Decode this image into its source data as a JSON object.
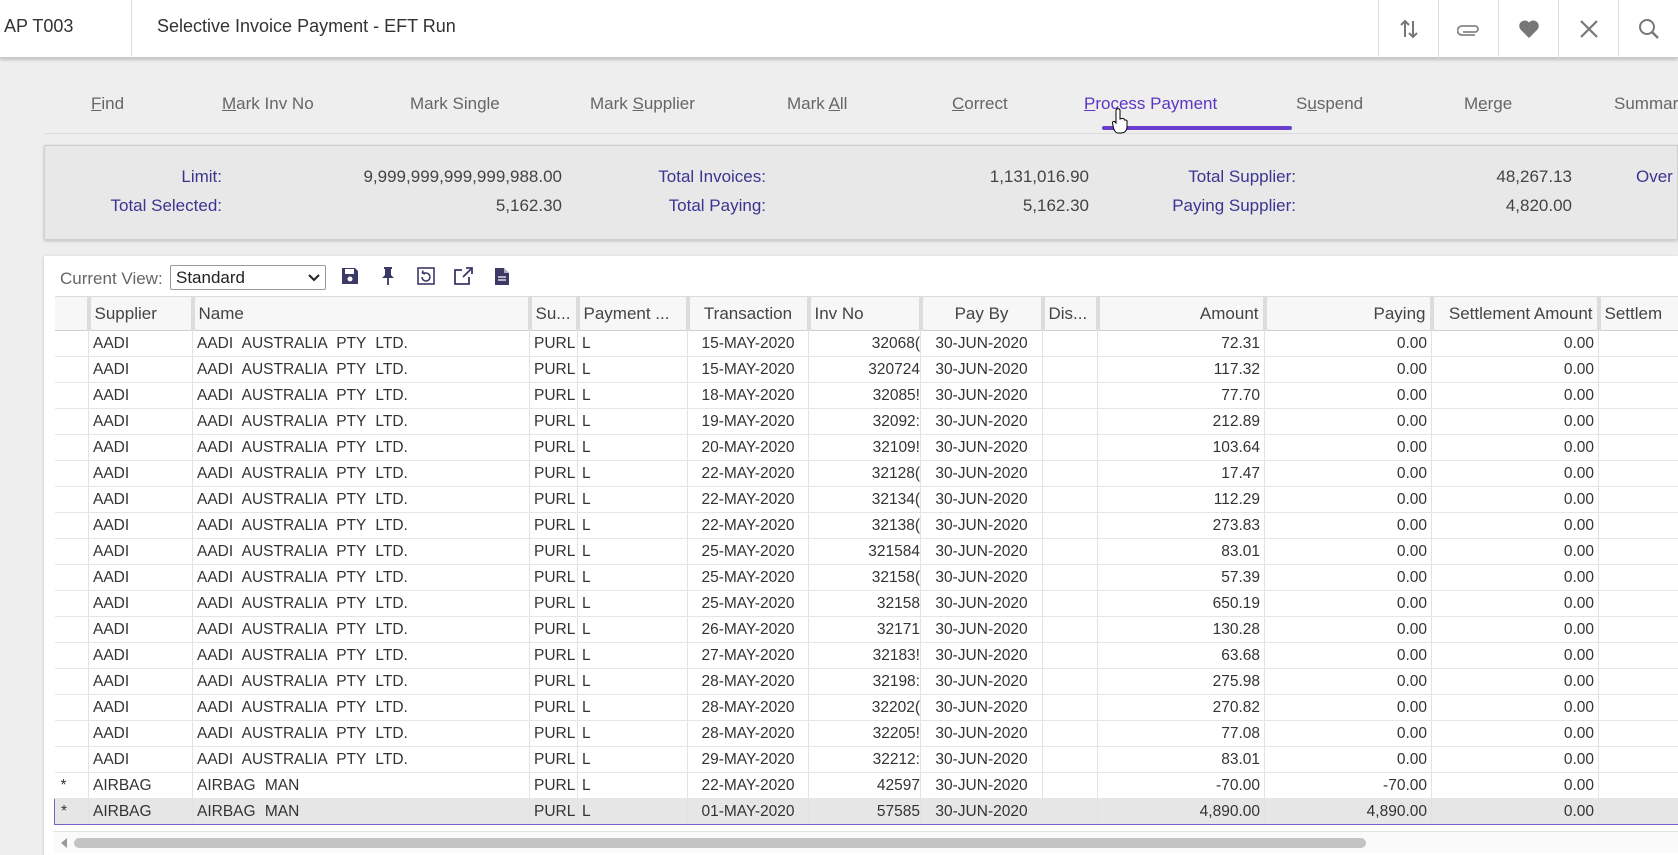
{
  "header": {
    "code": "AP T003",
    "title": "Selective Invoice Payment - EFT Run",
    "icons": [
      "sort-arrows-icon",
      "paperclip-icon",
      "heart-icon",
      "close-icon",
      "search-icon"
    ]
  },
  "toolbar": {
    "tabs": [
      {
        "label": "Find",
        "mnemonic": "F"
      },
      {
        "label": "Mark Inv No",
        "mnemonic": "M"
      },
      {
        "label": "Mark Single"
      },
      {
        "label": "Mark Supplier",
        "mnemonic": "S"
      },
      {
        "label": "Mark All",
        "mnemonic": "A"
      },
      {
        "label": "Correct",
        "mnemonic": "C"
      },
      {
        "label": "Process Payment",
        "mnemonic": "P",
        "active": true
      },
      {
        "label": "Suspend",
        "mnemonic": "u"
      },
      {
        "label": "Merge",
        "mnemonic": "e"
      },
      {
        "label": "Summar"
      }
    ],
    "accent_color": "#6a3fd0"
  },
  "summary": {
    "limit_label": "Limit:",
    "limit_value": "9,999,999,999,999,988.00",
    "total_selected_label": "Total Selected:",
    "total_selected_value": "5,162.30",
    "total_invoices_label": "Total Invoices:",
    "total_invoices_value": "1,131,016.90",
    "total_paying_label": "Total Paying:",
    "total_paying_value": "5,162.30",
    "total_supplier_label": "Total Supplier:",
    "total_supplier_value": "48,267.13",
    "paying_supplier_label": "Paying Supplier:",
    "paying_supplier_value": "4,820.00",
    "over_label": "Over I"
  },
  "grid": {
    "current_view_label": "Current View:",
    "current_view_value": "Standard",
    "toolbar_icons": [
      "save-icon",
      "pin-icon",
      "reset-view-icon",
      "export-icon",
      "document-icon"
    ],
    "columns": [
      "",
      "Supplier",
      "Name",
      "Su...",
      "Payment ...",
      "Transaction",
      "Inv No",
      "Pay By",
      "Dis...",
      "Amount",
      "Paying",
      "Settlement Amount",
      "Settlem"
    ],
    "rows": [
      [
        "",
        "AADI",
        "AADI  AUSTRALIA  PTY LTD.",
        "PURL",
        "L",
        "15-MAY-2020",
        "32068(",
        "30-JUN-2020",
        "",
        "72.31",
        "0.00",
        "0.00",
        ""
      ],
      [
        "",
        "AADI",
        "AADI  AUSTRALIA  PTY LTD.",
        "PURL",
        "L",
        "15-MAY-2020",
        "320724",
        "30-JUN-2020",
        "",
        "117.32",
        "0.00",
        "0.00",
        ""
      ],
      [
        "",
        "AADI",
        "AADI  AUSTRALIA  PTY LTD.",
        "PURL",
        "L",
        "18-MAY-2020",
        "32085!",
        "30-JUN-2020",
        "",
        "77.70",
        "0.00",
        "0.00",
        ""
      ],
      [
        "",
        "AADI",
        "AADI  AUSTRALIA  PTY LTD.",
        "PURL",
        "L",
        "19-MAY-2020",
        "32092:",
        "30-JUN-2020",
        "",
        "212.89",
        "0.00",
        "0.00",
        ""
      ],
      [
        "",
        "AADI",
        "AADI  AUSTRALIA  PTY LTD.",
        "PURL",
        "L",
        "20-MAY-2020",
        "32109!",
        "30-JUN-2020",
        "",
        "103.64",
        "0.00",
        "0.00",
        ""
      ],
      [
        "",
        "AADI",
        "AADI  AUSTRALIA  PTY LTD.",
        "PURL",
        "L",
        "22-MAY-2020",
        "32128(",
        "30-JUN-2020",
        "",
        "17.47",
        "0.00",
        "0.00",
        ""
      ],
      [
        "",
        "AADI",
        "AADI  AUSTRALIA  PTY LTD.",
        "PURL",
        "L",
        "22-MAY-2020",
        "32134(",
        "30-JUN-2020",
        "",
        "112.29",
        "0.00",
        "0.00",
        ""
      ],
      [
        "",
        "AADI",
        "AADI  AUSTRALIA  PTY LTD.",
        "PURL",
        "L",
        "22-MAY-2020",
        "32138(",
        "30-JUN-2020",
        "",
        "273.83",
        "0.00",
        "0.00",
        ""
      ],
      [
        "",
        "AADI",
        "AADI  AUSTRALIA  PTY LTD.",
        "PURL",
        "L",
        "25-MAY-2020",
        "321584",
        "30-JUN-2020",
        "",
        "83.01",
        "0.00",
        "0.00",
        ""
      ],
      [
        "",
        "AADI",
        "AADI  AUSTRALIA  PTY LTD.",
        "PURL",
        "L",
        "25-MAY-2020",
        "32158(",
        "30-JUN-2020",
        "",
        "57.39",
        "0.00",
        "0.00",
        ""
      ],
      [
        "",
        "AADI",
        "AADI  AUSTRALIA  PTY LTD.",
        "PURL",
        "L",
        "25-MAY-2020",
        "32158",
        "30-JUN-2020",
        "",
        "650.19",
        "0.00",
        "0.00",
        ""
      ],
      [
        "",
        "AADI",
        "AADI  AUSTRALIA  PTY LTD.",
        "PURL",
        "L",
        "26-MAY-2020",
        "32171",
        "30-JUN-2020",
        "",
        "130.28",
        "0.00",
        "0.00",
        ""
      ],
      [
        "",
        "AADI",
        "AADI  AUSTRALIA  PTY LTD.",
        "PURL",
        "L",
        "27-MAY-2020",
        "32183!",
        "30-JUN-2020",
        "",
        "63.68",
        "0.00",
        "0.00",
        ""
      ],
      [
        "",
        "AADI",
        "AADI  AUSTRALIA  PTY LTD.",
        "PURL",
        "L",
        "28-MAY-2020",
        "32198:",
        "30-JUN-2020",
        "",
        "275.98",
        "0.00",
        "0.00",
        ""
      ],
      [
        "",
        "AADI",
        "AADI  AUSTRALIA  PTY LTD.",
        "PURL",
        "L",
        "28-MAY-2020",
        "32202(",
        "30-JUN-2020",
        "",
        "270.82",
        "0.00",
        "0.00",
        ""
      ],
      [
        "",
        "AADI",
        "AADI  AUSTRALIA  PTY LTD.",
        "PURL",
        "L",
        "28-MAY-2020",
        "32205!",
        "30-JUN-2020",
        "",
        "77.08",
        "0.00",
        "0.00",
        ""
      ],
      [
        "",
        "AADI",
        "AADI  AUSTRALIA  PTY LTD.",
        "PURL",
        "L",
        "29-MAY-2020",
        "32212:",
        "30-JUN-2020",
        "",
        "83.01",
        "0.00",
        "0.00",
        ""
      ],
      [
        "*",
        "AIRBAG",
        "AIRBAG MAN",
        "PURL",
        "L",
        "22-MAY-2020",
        "42597",
        "30-JUN-2020",
        "",
        "-70.00",
        "-70.00",
        "0.00",
        ""
      ],
      [
        "*",
        "AIRBAG",
        "AIRBAG MAN",
        "PURL",
        "L",
        "01-MAY-2020",
        "57585",
        "30-JUN-2020",
        "",
        "4,890.00",
        "4,890.00",
        "0.00",
        ""
      ]
    ],
    "selected_row": 18
  }
}
